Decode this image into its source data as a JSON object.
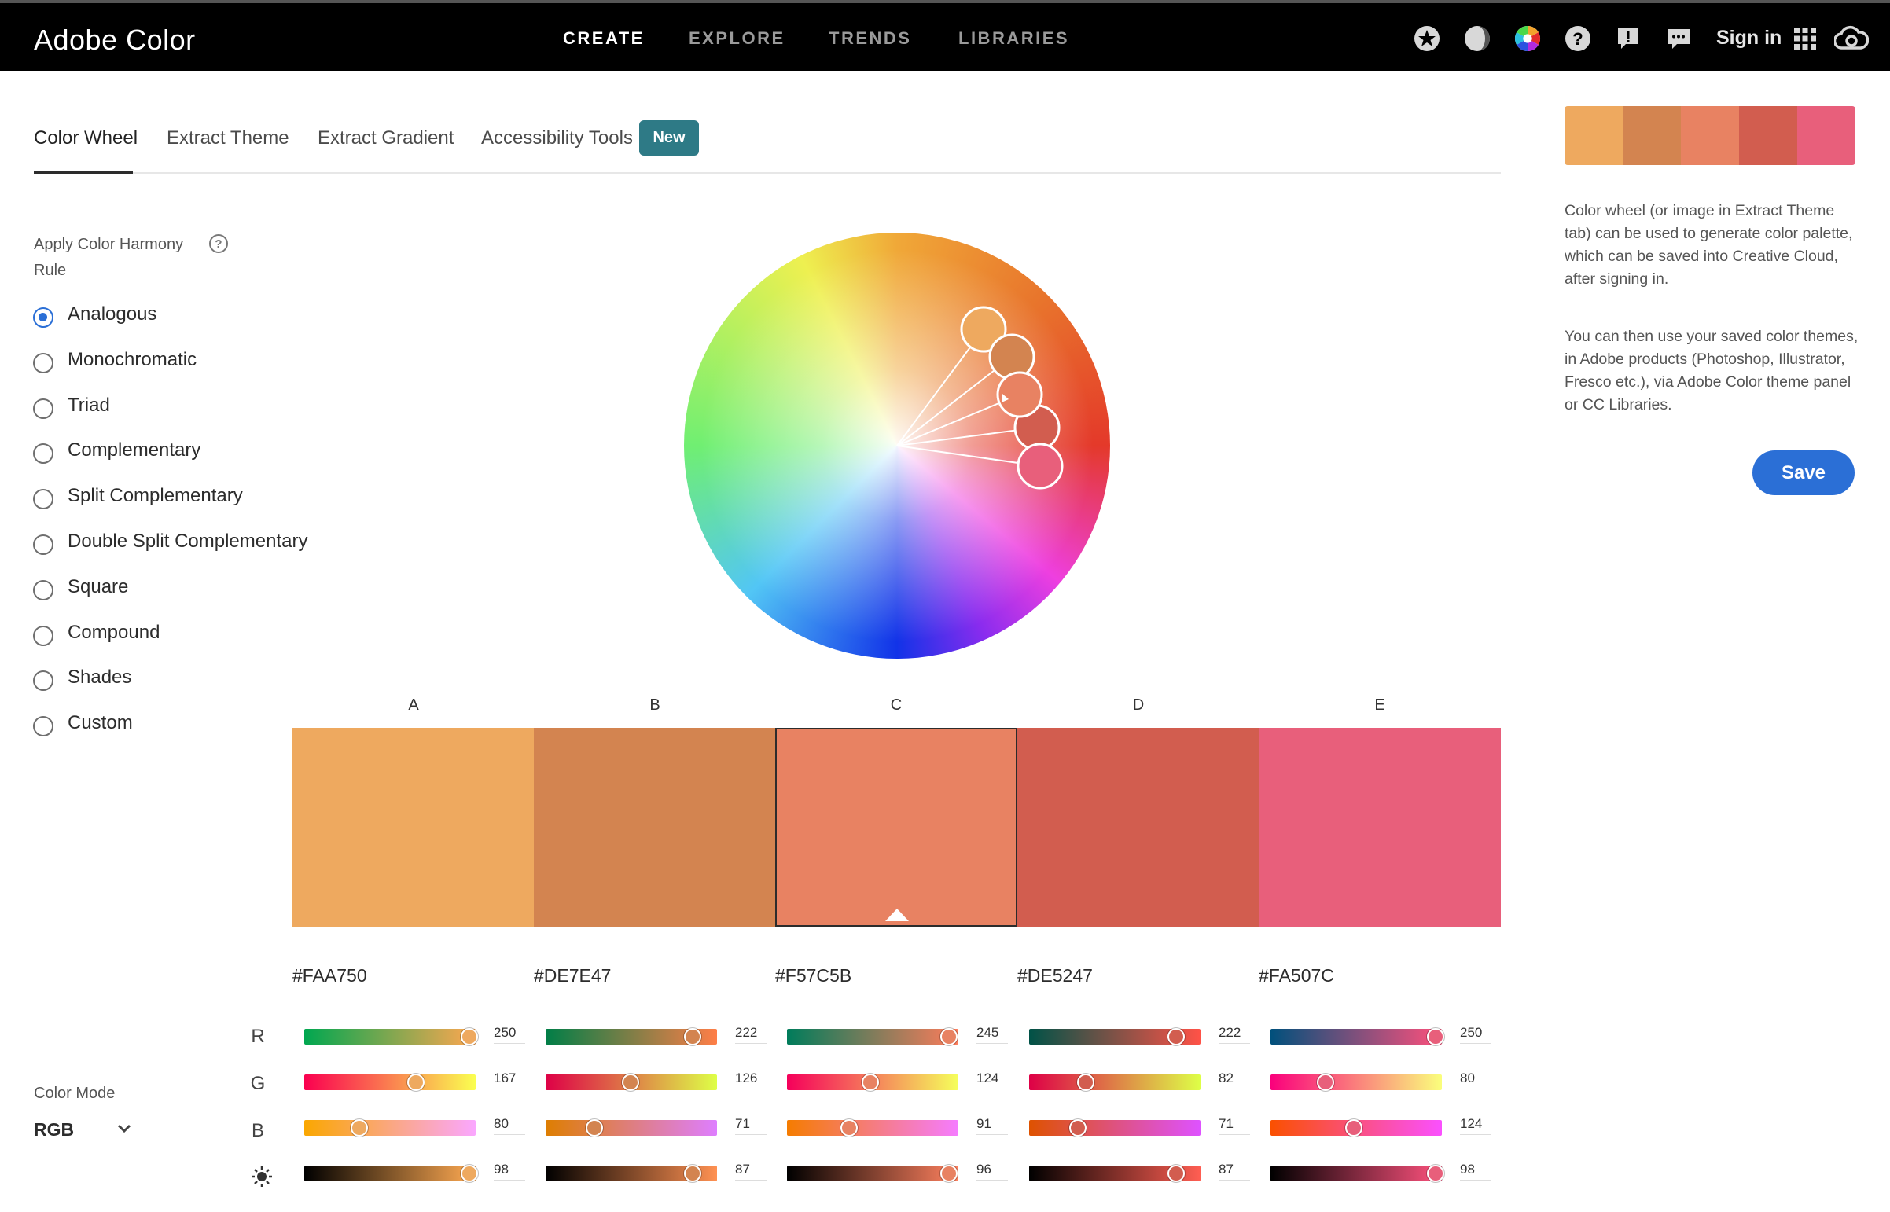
{
  "app": {
    "title": "Adobe Color"
  },
  "nav": {
    "create": "CREATE",
    "explore": "EXPLORE",
    "trends": "TRENDS",
    "libraries": "LIBRARIES",
    "sign_in": "Sign in"
  },
  "tabs": {
    "color_wheel": "Color Wheel",
    "extract_theme": "Extract Theme",
    "extract_gradient": "Extract Gradient",
    "accessibility_tools": "Accessibility Tools",
    "new_badge": "New"
  },
  "harmony": {
    "title": "Apply Color Harmony Rule",
    "help": "?",
    "rules": [
      {
        "label": "Analogous",
        "selected": true
      },
      {
        "label": "Monochromatic",
        "selected": false
      },
      {
        "label": "Triad",
        "selected": false
      },
      {
        "label": "Complementary",
        "selected": false
      },
      {
        "label": "Split Complementary",
        "selected": false
      },
      {
        "label": "Double Split Complementary",
        "selected": false
      },
      {
        "label": "Square",
        "selected": false
      },
      {
        "label": "Compound",
        "selected": false
      },
      {
        "label": "Shades",
        "selected": false
      },
      {
        "label": "Custom",
        "selected": false
      }
    ]
  },
  "color_mode": {
    "label": "Color Mode",
    "value": "RGB"
  },
  "swatches": [
    {
      "letter": "A",
      "hex": "#FAA750",
      "r": "250",
      "g": "167",
      "b": "80",
      "brightness": "98",
      "color": "#EEA95F"
    },
    {
      "letter": "B",
      "hex": "#DE7E47",
      "r": "222",
      "g": "126",
      "b": "71",
      "brightness": "87",
      "color": "#D38450"
    },
    {
      "letter": "C",
      "hex": "#F57C5B",
      "r": "245",
      "g": "124",
      "b": "91",
      "brightness": "96",
      "color": "#E88262"
    },
    {
      "letter": "D",
      "hex": "#DE5247",
      "r": "222",
      "g": "82",
      "b": "71",
      "brightness": "87",
      "color": "#D25D4F"
    },
    {
      "letter": "E",
      "hex": "#FA507C",
      "r": "250",
      "g": "80",
      "b": "124",
      "brightness": "98",
      "color": "#E85F7B"
    }
  ],
  "selected_swatch": "C",
  "channel_labels": {
    "r": "R",
    "g": "G",
    "b": "B"
  },
  "side_panel": {
    "info_1": "Color wheel (or image in Extract Theme tab) can be used to generate color palette, which can be saved into Creative Cloud, after signing in.",
    "info_2": "You can then use your saved color themes, in Adobe products (Photoshop, Illustrator, Fresco etc.), via Adobe Color theme panel or CC Libraries.",
    "save": "Save"
  },
  "icons": [
    "favorites-icon",
    "dark-mode-icon",
    "color-wheel-icon",
    "help-icon",
    "alert-icon",
    "feedback-icon",
    "apps-grid-icon",
    "creative-cloud-icon",
    "brightness-icon",
    "chevron-down-icon"
  ]
}
